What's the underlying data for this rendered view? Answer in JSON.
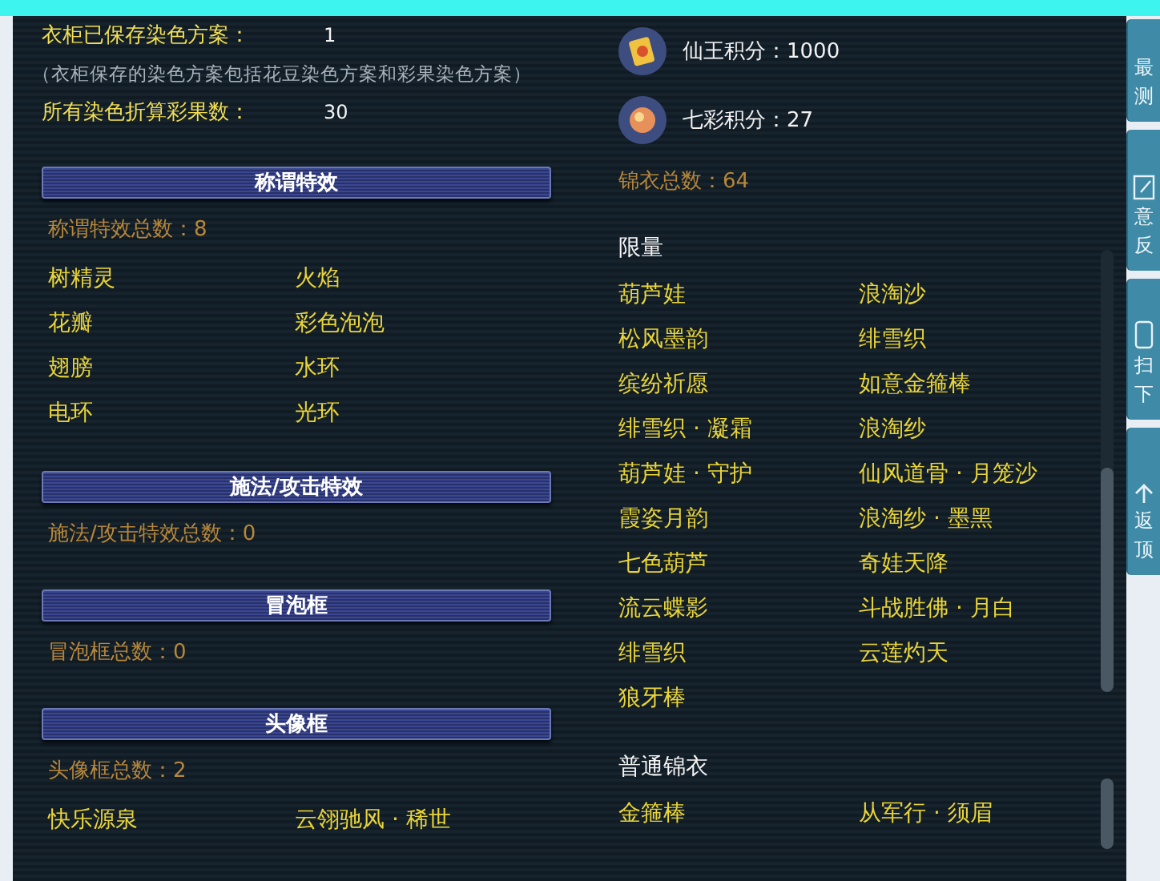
{
  "wardrobe": [
    {
      "kind": "stat",
      "label": "衣柜已保存染色方案：",
      "value": "1"
    },
    {
      "kind": "note",
      "label": "（衣柜保存的染色方案包括花豆染色方案和彩果染色方案）"
    },
    {
      "kind": "stat",
      "label": "所有染色折算彩果数：",
      "value": "30"
    }
  ],
  "sections": [
    {
      "title": "称谓特效",
      "count": "称谓特效总数：8",
      "items": [
        "树精灵",
        "火焰",
        "花瓣",
        "彩色泡泡",
        "翅膀",
        "水环",
        "电环",
        "光环"
      ]
    },
    {
      "title": "施法/攻击特效",
      "count": "施法/攻击特效总数：0"
    },
    {
      "title": "冒泡框",
      "count": "冒泡框总数：0"
    },
    {
      "title": "头像框",
      "count": "头像框总数：2",
      "items": [
        "快乐源泉",
        "云翎驰风 · 稀世"
      ]
    }
  ],
  "points": [
    {
      "kind": "card",
      "label": "仙王积分：1000"
    },
    {
      "kind": "orb",
      "label": "七彩积分：27"
    }
  ],
  "costume_count": "锦衣总数：64",
  "groups": [
    {
      "title": "限量",
      "items": [
        "葫芦娃",
        "浪淘沙",
        "松风墨韵",
        "绯雪织",
        "缤纷祈愿",
        "如意金箍棒",
        "绯雪织 · 凝霜",
        "浪淘纱",
        "葫芦娃 · 守护",
        "仙风道骨 · 月笼沙",
        "霞姿月韵",
        "浪淘纱 · 墨黑",
        "七色葫芦",
        "奇娃天降",
        "流云蝶影",
        "斗战胜佛 · 月白",
        "绯雪织",
        "云莲灼天",
        "狼牙棒"
      ]
    },
    {
      "title": "普通锦衣",
      "items": [
        "金箍棒",
        "从军行 · 须眉"
      ]
    }
  ],
  "side_buttons": [
    {
      "kind": "top",
      "lines": [
        "最",
        "测"
      ]
    },
    {
      "kind": "feedback",
      "lines": [
        "意",
        "反"
      ]
    },
    {
      "kind": "phone",
      "lines": [
        "扫",
        "下"
      ]
    },
    {
      "kind": "up",
      "lines": [
        "返",
        "顶"
      ]
    }
  ]
}
